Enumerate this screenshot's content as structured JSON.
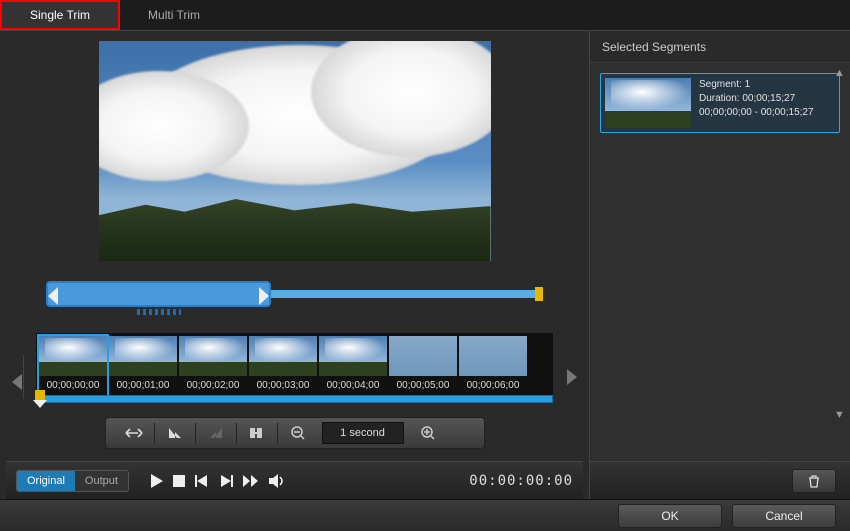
{
  "tabs": {
    "single": "Single Trim",
    "multi": "Multi Trim"
  },
  "selected_segments_title": "Selected Segments",
  "segments": [
    {
      "title": "Segment: 1",
      "duration": "Duration: 00;00;15;27",
      "range": "00;00;00;00 - 00;00;15;27"
    }
  ],
  "thumbs": [
    {
      "tc": "00;00;00;00",
      "sel": true,
      "grass": false
    },
    {
      "tc": "00;00;01;00",
      "sel": false,
      "grass": false
    },
    {
      "tc": "00;00;02;00",
      "sel": false,
      "grass": false
    },
    {
      "tc": "00;00;03;00",
      "sel": false,
      "grass": false
    },
    {
      "tc": "00;00;04;00",
      "sel": false,
      "grass": false
    },
    {
      "tc": "00;00;05;00",
      "sel": false,
      "grass": true
    },
    {
      "tc": "00;00;06;00",
      "sel": false,
      "grass": true
    }
  ],
  "toolbar": {
    "interval": "1 second"
  },
  "view": {
    "original": "Original",
    "output": "Output"
  },
  "main_timecode": "00:00:00:00",
  "buttons": {
    "ok": "OK",
    "cancel": "Cancel"
  }
}
